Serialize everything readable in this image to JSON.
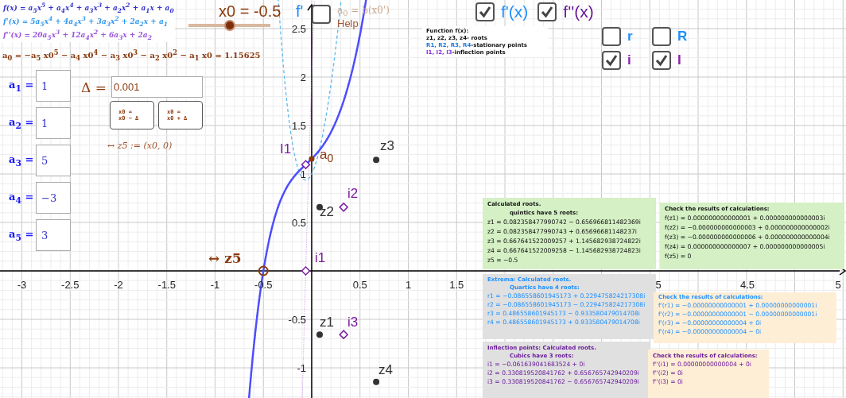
{
  "formulas": [
    {
      "text": "f(x) = a$_{5}$x$^{5}$ + a$_{4}$x$^{4}$ + a$_{3}$x$^{3}$ + a$_{2}$x$^{2}$ + a$_{1}$x + a$_{0}$",
      "color": "#3333cc"
    },
    {
      "text": "f'(x) = 5a$_{5}$x$^{4}$ + 4a$_{4}$x$^{3}$ + 3a$_{3}$x$^{2}$ + 2a$_{2}$x + a$_{1}$",
      "color": "#3399ee"
    },
    {
      "text": "f''(x) = 20a$_{5}$x$^{3}$ + 12a$_{4}$x$^{2}$ + 6a$_{3}$x + 2a$_{2}$",
      "color": "#9955dd"
    }
  ],
  "a0_formula": "a$_{0}$ = −a$_{5}$ x0$^{5}$ − a$_{4}$ x0$^{4}$ − a$_{3}$ x0$^{3}$ − a$_{2}$ x0$^{2}$ − a$_{1}$ x0 = 1.15625",
  "slider": {
    "label": "x0 = -0.5",
    "level": 0.5
  },
  "curve_label": "f'",
  "help": {
    "formula": "a$_{0}$ = b(x0')",
    "label": "Help",
    "checked": false
  },
  "top_checkboxes": [
    {
      "label": "f'(x)",
      "checked": true,
      "color": "#1e90ff"
    },
    {
      "label": "f''(x)",
      "checked": true,
      "color": "#6a1b9a"
    }
  ],
  "point_checkboxes": [
    {
      "label": "r",
      "checked": false,
      "color": "#1e90ff"
    },
    {
      "label": "R",
      "checked": false,
      "color": "#1e90ff"
    },
    {
      "label": "i",
      "checked": true,
      "color": "#8e24aa"
    },
    {
      "label": "I",
      "checked": true,
      "color": "#8e24aa"
    }
  ],
  "legend": [
    {
      "text": "Function f(x):"
    },
    {
      "text": "z1, z2, z3, z4-  roots"
    },
    {
      "highlight": "R1, R2, R3, R4",
      "text": "-stationary points",
      "color": "#1e78e0"
    },
    {
      "highlight": "I1, I2, I3",
      "text": "-inflection points",
      "color": "#8a2be2"
    }
  ],
  "coefficients": [
    {
      "label": "a$_{1}$ =",
      "value": "1"
    },
    {
      "label": "a$_{2}$ =",
      "value": "1"
    },
    {
      "label": "a$_{3}$ =",
      "value": "5"
    },
    {
      "label": "a$_{4}$ =",
      "value": "−3"
    },
    {
      "label": "a$_{5}$ =",
      "value": "3"
    }
  ],
  "delta": {
    "label": "Δ =",
    "value": "0.001"
  },
  "step_buttons": [
    {
      "line1": "x0 =",
      "line2": "x0 − Δ"
    },
    {
      "line1": "x0 =",
      "line2": "x0 + Δ"
    }
  ],
  "z5_definition": "↔ z5 := (x0, 0)",
  "x_axis_labels": [
    "-3",
    "-2.5",
    "-2",
    "-1.5",
    "-1",
    "-0.5",
    "0.5",
    "1",
    "1.5",
    "5",
    "4.5",
    "5"
  ],
  "y_axis_labels": [
    "2.5",
    "2",
    "1.5",
    "1",
    "0.5",
    "-0.5",
    "-1"
  ],
  "point_labels": [
    "I1",
    "a$_{0}$",
    "z3",
    "z2",
    "i2",
    "↔ z5",
    "i1",
    "z1",
    "i3",
    "z4"
  ],
  "panels": [
    {
      "kind": "roots",
      "title": "Calculated roots.",
      "subtitle": "quintics have 5 roots:",
      "lines": [
        "z1 = 0.082358477990742 − 0.656966811482369i",
        "z2 = 0.082358477990743 + 0.65696681148237i",
        "z3 = 0.667641522009257 + 1.145682938724822i",
        "z4 = 0.667641522009258 − 1.145682938724823i",
        "z5 = −0.5"
      ]
    },
    {
      "kind": "check_roots",
      "title": "Check the results of calculations:",
      "lines": [
        "f(z1) = 0.000000000000001 + 0.000000000000003i",
        "f(z2) = −0.000000000000003 + 0.000000000000002i",
        "f(z3) = −0.000000000000006 + 0.000000000000004i",
        "f(z4) = 0.000000000000007 + 0.000000000000005i",
        "f(z5) = 0"
      ]
    },
    {
      "kind": "extrema",
      "title": "Extrema: Calculated roots.",
      "subtitle": "Quartics have 4 roots:",
      "lines": [
        "r1 = −0.086558601945173 + 0.229475824217308i",
        "r2 = −0.086558601945173 − 0.229475824217308i",
        "r3 = 0.486558601945173 − 0.933580479014708i",
        "r4 = 0.486558601945173 + 0.933580479014708i"
      ]
    },
    {
      "kind": "check_extrema",
      "title": "Check the results of calculations:",
      "lines": [
        "f'(r1) = −0.00000000000001 + 0.00000000000001i",
        "f'(r2) = −0.00000000000001 − 0.00000000000001i",
        "f'(r3) = −0.00000000000004 + 0i",
        "f'(r4) = −0.00000000000004 − 0i"
      ]
    },
    {
      "kind": "inflection",
      "title": "Inflection points: Calculated roots.",
      "subtitle": "Cubics have 3 roots:",
      "lines": [
        "i1 = −0.061639041683524 + 0i",
        "i2 = 0.330819520841762 + 0.656765742940209i",
        "i3 = 0.330819520841762 − 0.656765742940209i"
      ]
    },
    {
      "kind": "check_inflection",
      "title": "Check the results of calculations:",
      "lines": [
        "f''(i1) = 0.00000000000004 + 0i",
        "f''(i2) = 0i",
        "f''(i3) = 0i"
      ]
    }
  ]
}
